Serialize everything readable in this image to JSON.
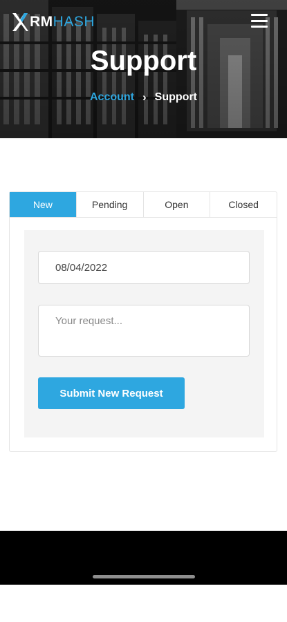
{
  "header": {
    "logo": {
      "prefix": "RM",
      "suffix": "HASH",
      "accent": "#2ea7e0"
    },
    "menu_icon": "hamburger-menu-icon",
    "title": "Support",
    "breadcrumb": {
      "parent": "Account",
      "separator": "›",
      "current": "Support"
    }
  },
  "tabs": [
    {
      "label": "New",
      "active": true
    },
    {
      "label": "Pending",
      "active": false
    },
    {
      "label": "Open",
      "active": false
    },
    {
      "label": "Closed",
      "active": false
    }
  ],
  "form": {
    "date_value": "08/04/2022",
    "request_placeholder": "Your request...",
    "submit_label": "Submit New Request"
  },
  "colors": {
    "accent": "#2ea7e0",
    "panel": "#f4f4f4",
    "bottom_bar": "#000000"
  }
}
